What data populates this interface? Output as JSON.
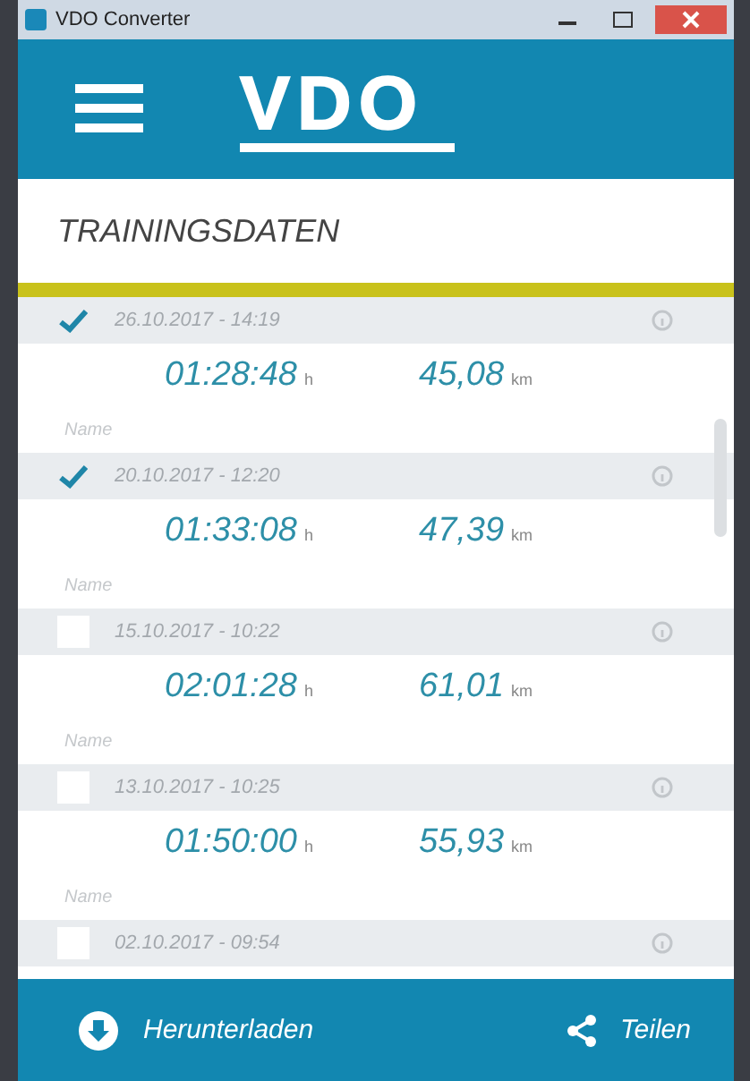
{
  "window": {
    "title": "VDO Converter"
  },
  "header": {
    "logo": "VDO"
  },
  "section_title": "TRAININGSDATEN",
  "trainings": [
    {
      "date": "26.10.2017 - 14:19",
      "checked": true,
      "duration": "01:28:48",
      "duration_unit": "h",
      "distance": "45,08",
      "distance_unit": "km",
      "name_placeholder": "Name"
    },
    {
      "date": "20.10.2017 - 12:20",
      "checked": true,
      "duration": "01:33:08",
      "duration_unit": "h",
      "distance": "47,39",
      "distance_unit": "km",
      "name_placeholder": "Name"
    },
    {
      "date": "15.10.2017 - 10:22",
      "checked": false,
      "duration": "02:01:28",
      "duration_unit": "h",
      "distance": "61,01",
      "distance_unit": "km",
      "name_placeholder": "Name"
    },
    {
      "date": "13.10.2017 - 10:25",
      "checked": false,
      "duration": "01:50:00",
      "duration_unit": "h",
      "distance": "55,93",
      "distance_unit": "km",
      "name_placeholder": "Name"
    },
    {
      "date": "02.10.2017 - 09:54",
      "checked": false
    }
  ],
  "bottom_bar": {
    "download": "Herunterladen",
    "share": "Teilen"
  }
}
